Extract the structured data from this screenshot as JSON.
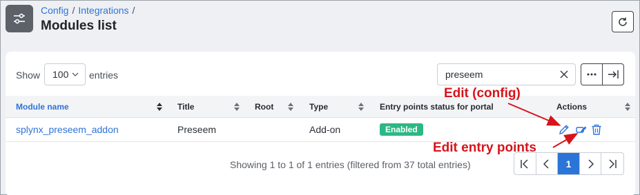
{
  "header": {
    "breadcrumb": [
      "Config",
      "Integrations"
    ],
    "breadcrumb_trailing_sep": "/",
    "title": "Modules list",
    "icon": "sliders-icon",
    "refresh_icon": "refresh-icon"
  },
  "toolbar": {
    "show_label": "Show",
    "entries_value": "100",
    "entries_label": "entries",
    "search_value": "preseem",
    "more_icon": "more-horizontal-icon",
    "expand_icon": "arrow-right-to-bar-icon"
  },
  "table": {
    "columns": [
      "Module name",
      "Title",
      "Root",
      "Type",
      "Entry points status for portal",
      "Actions"
    ],
    "rows": [
      {
        "module_name": "splynx_preseem_addon",
        "title": "Preseem",
        "root": "",
        "type": "Add-on",
        "status": "Enabled"
      }
    ]
  },
  "footer": {
    "info": "Showing 1 to 1 of 1 entries (filtered from 37 total entries)",
    "current_page": "1"
  },
  "annotations": {
    "edit_config": "Edit (config)",
    "edit_entry_points": "Edit entry points",
    "color": "#d6141b"
  },
  "colors": {
    "link": "#2f73d8",
    "badge": "#2cb884",
    "active_page": "#2b74d8"
  }
}
